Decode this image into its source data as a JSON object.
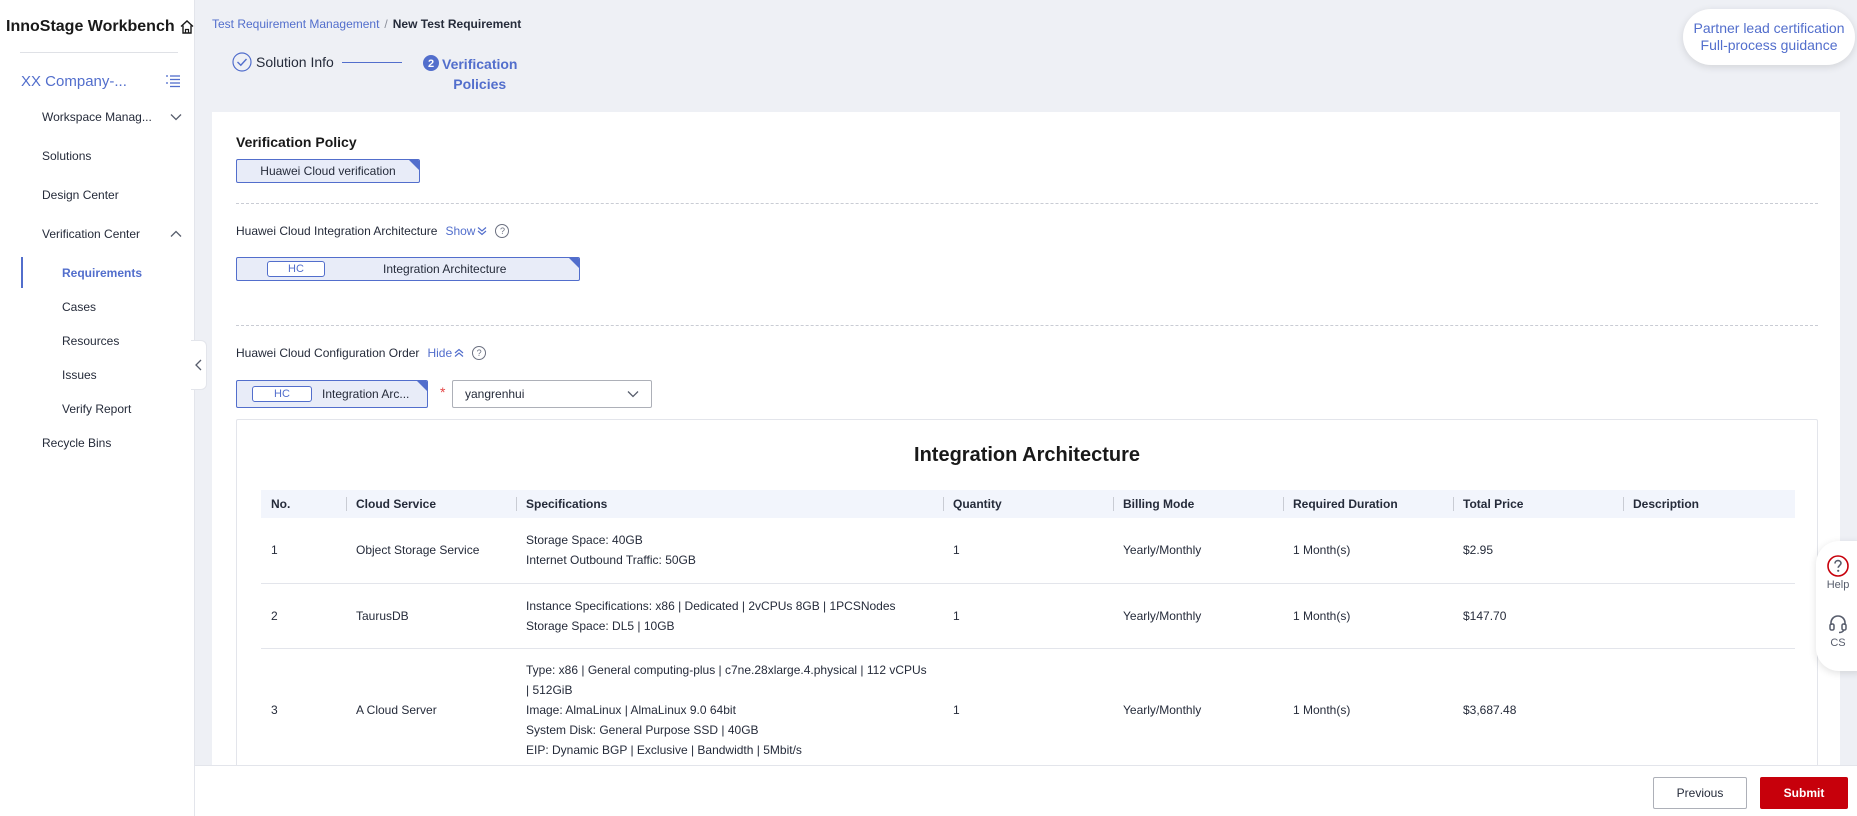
{
  "app": {
    "title": "InnoStage Workbench",
    "icon": "home-icon"
  },
  "sidebar": {
    "company": "XX Company-...",
    "items": [
      {
        "label": "Workspace Manag...",
        "expand": "chevron-down-icon"
      },
      {
        "label": "Solutions"
      },
      {
        "label": "Design Center"
      },
      {
        "label": "Verification Center",
        "expand": "chevron-up-icon"
      },
      {
        "label": "Requirements",
        "active": true
      },
      {
        "label": "Cases"
      },
      {
        "label": "Resources"
      },
      {
        "label": "Issues"
      },
      {
        "label": "Verify Report"
      },
      {
        "label": "Recycle Bins"
      }
    ]
  },
  "breadcrumb": {
    "parent": "Test Requirement Management",
    "separator": "/",
    "current": "New Test Requirement"
  },
  "steps": {
    "step1": "Solution Info",
    "step2_line1": "Verification",
    "step2_line2": "Policies",
    "step2_number": "2"
  },
  "partner": {
    "line1": "Partner lead certification",
    "line2": "Full-process guidance"
  },
  "policy": {
    "title": "Verification Policy",
    "tag": "Huawei Cloud verification"
  },
  "integration": {
    "label": "Huawei Cloud Integration Architecture",
    "toggle": "Show",
    "chip": "HC",
    "name": "Integration Architecture"
  },
  "config": {
    "label": "Huawei Cloud Configuration Order",
    "toggle": "Hide",
    "chip": "HC",
    "name": "Integration Arc...",
    "required_mark": "*",
    "select_value": "yangrenhui"
  },
  "arch": {
    "title": "Integration Architecture",
    "columns": [
      "No.",
      "Cloud Service",
      "Specifications",
      "Quantity",
      "Billing Mode",
      "Required Duration",
      "Total Price",
      "Description"
    ],
    "rows": [
      {
        "no": "1",
        "service": "Object Storage Service",
        "specs": [
          "Storage Space: 40GB",
          "Internet Outbound Traffic: 50GB"
        ],
        "quantity": "1",
        "billing": "Yearly/Monthly",
        "duration": "1 Month(s)",
        "price": "$2.95",
        "description": ""
      },
      {
        "no": "2",
        "service": "TaurusDB",
        "specs": [
          "Instance Specifications: x86 | Dedicated | 2vCPUs 8GB | 1PCSNodes",
          "Storage Space: DL5 | 10GB"
        ],
        "quantity": "1",
        "billing": "Yearly/Monthly",
        "duration": "1 Month(s)",
        "price": "$147.70",
        "description": ""
      },
      {
        "no": "3",
        "service": "A Cloud Server",
        "specs": [
          "Type: x86 | General computing-plus | c7ne.28xlarge.4.physical | 112 vCPUs",
          "| 512GiB",
          "Image: AlmaLinux | AlmaLinux 9.0 64bit",
          "System Disk: General Purpose SSD | 40GB",
          "EIP: Dynamic BGP | Exclusive | Bandwidth | 5Mbit/s"
        ],
        "quantity": "1",
        "billing": "Yearly/Monthly",
        "duration": "1 Month(s)",
        "price": "$3,687.48",
        "description": ""
      }
    ]
  },
  "float": {
    "help": "Help",
    "help_icon": "question-circle-icon",
    "cs": "CS",
    "cs_icon": "headset-icon"
  },
  "footer": {
    "previous": "Previous",
    "submit": "Submit"
  },
  "colors": {
    "accent": "#526ecc",
    "submit": "#c7000b",
    "background": "#eef0f5"
  }
}
